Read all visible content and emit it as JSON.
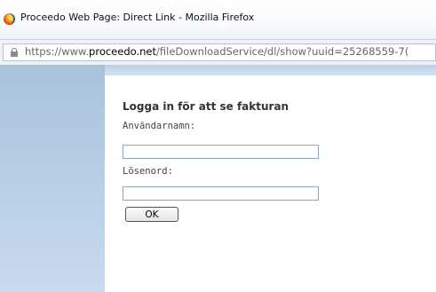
{
  "window": {
    "title": "Proceedo Web Page: Direct Link - Mozilla Firefox",
    "browser_icon": "firefox-icon"
  },
  "address_bar": {
    "security_icon": "lock-icon",
    "url_prefix": "https://www.",
    "url_domain": "proceedo.net",
    "url_path": "/fileDownloadService/dl/show?uuid=25268559-7("
  },
  "login": {
    "heading": "Logga in för att se fakturan",
    "username_label": "Användarnamn:",
    "username_value": "",
    "password_label": "Lösenord:",
    "password_value": "",
    "ok_label": "OK"
  },
  "colors": {
    "panel_blue": "#b9d0e6",
    "input_border": "#8da6c4"
  }
}
